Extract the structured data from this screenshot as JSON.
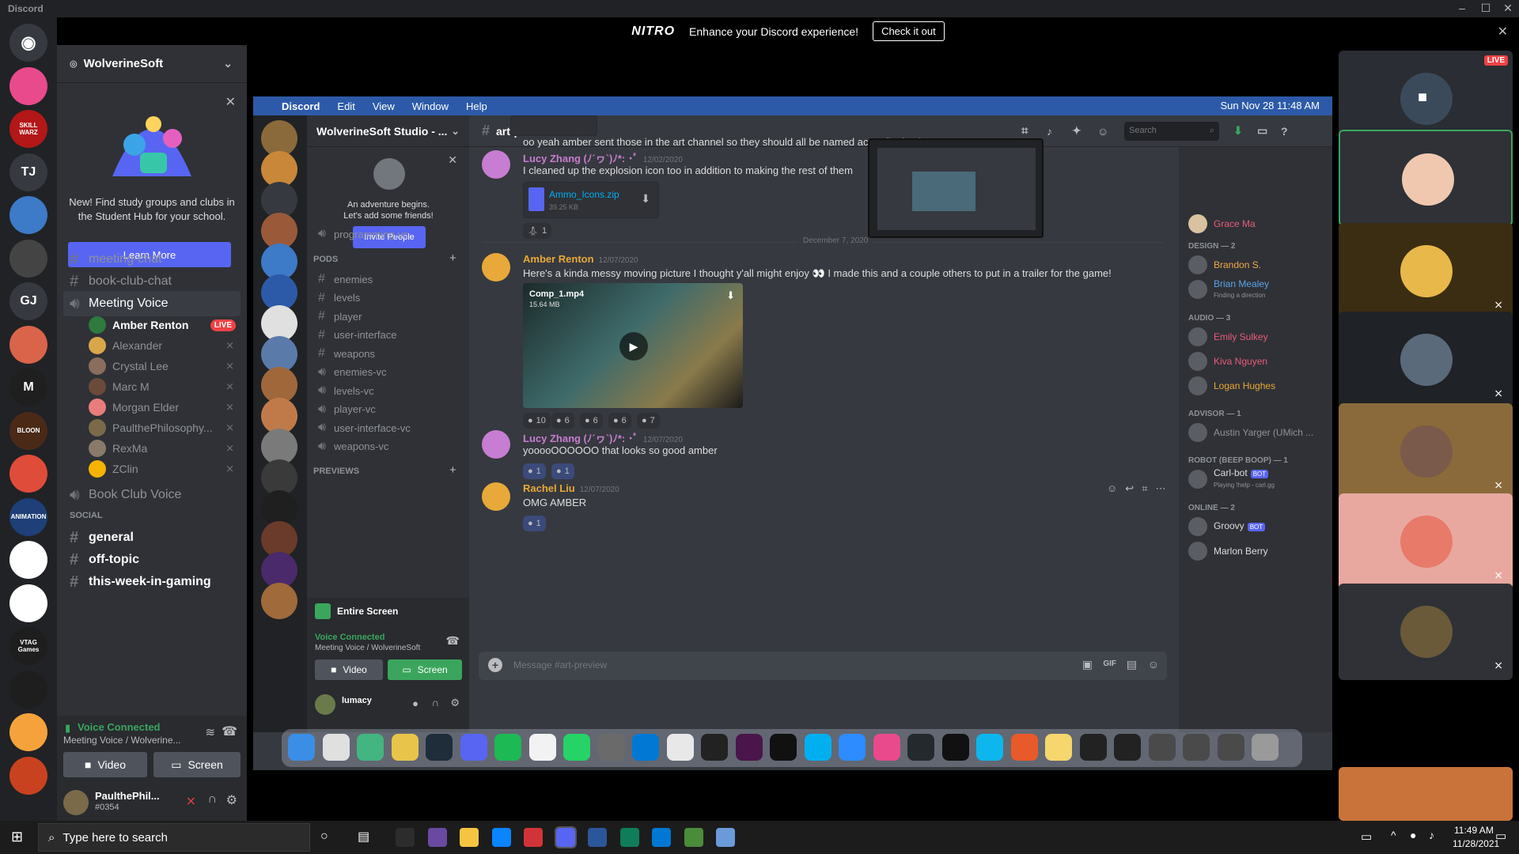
{
  "app": {
    "title": "Discord"
  },
  "nitro": {
    "logo": "NITRO",
    "text": "Enhance your Discord experience!",
    "cta": "Check it out"
  },
  "guild_rail": [
    {
      "name": "home",
      "label": "",
      "color": "#36393f"
    },
    {
      "name": "server-p",
      "label": "",
      "color": "#e94a8c"
    },
    {
      "name": "skillwarz",
      "label": "SKILL WARZ",
      "color": "#b31717"
    },
    {
      "name": "tj",
      "label": "TJ",
      "color": "#36393f"
    },
    {
      "name": "robot",
      "label": "",
      "color": "#3d7ac7"
    },
    {
      "name": "controller",
      "label": "",
      "color": "#444"
    },
    {
      "name": "gj",
      "label": "GJ",
      "color": "#36393f"
    },
    {
      "name": "ui-server",
      "label": "",
      "color": "#d9644a"
    },
    {
      "name": "m-server",
      "label": "M",
      "color": "#1f1f1f"
    },
    {
      "name": "bloon",
      "label": "BLOON",
      "color": "#4a2a17"
    },
    {
      "name": "colorful",
      "label": "",
      "color": "#e04c3a"
    },
    {
      "name": "animation",
      "label": "ANIMATION",
      "color": "#1e3f78"
    },
    {
      "name": "wolverine1",
      "label": "",
      "color": "#fff"
    },
    {
      "name": "wolverine2",
      "label": "",
      "color": "#fff"
    },
    {
      "name": "vtag",
      "label": "VTAG Games",
      "color": "#1e1e1e"
    },
    {
      "name": "trophy",
      "label": "",
      "color": "#1e1e1e"
    },
    {
      "name": "fox",
      "label": "",
      "color": "#f6a23c"
    },
    {
      "name": "dark",
      "label": "",
      "color": "#c9421f"
    }
  ],
  "server": {
    "name": "WolverineSoft"
  },
  "promo": {
    "text": "New! Find study groups and clubs in the Student Hub for your school.",
    "button": "Learn More"
  },
  "channels": [
    {
      "type": "text",
      "name": "meeting-chat"
    },
    {
      "type": "text",
      "name": "book-club-chat"
    },
    {
      "type": "voice",
      "name": "Meeting Voice"
    }
  ],
  "voice_users": [
    {
      "name": "Amber Renton",
      "live": "LIVE",
      "color": "#2f7a3e"
    },
    {
      "name": "Alexander",
      "color": "#d9a64a"
    },
    {
      "name": "Crystal Lee",
      "color": "#8a6d5c"
    },
    {
      "name": "Marc M",
      "color": "#6b4a3a"
    },
    {
      "name": "Morgan Elder",
      "color": "#e97c7c"
    },
    {
      "name": "PaulthePhilosophy...",
      "color": "#7a6a4a"
    },
    {
      "name": "RexMa",
      "color": "#8a7a6a"
    },
    {
      "name": "ZClin",
      "color": "#f5b400"
    }
  ],
  "channels_after": [
    {
      "type": "voice",
      "name": "Book Club Voice"
    }
  ],
  "category_social": "SOCIAL",
  "social_channels": [
    "general",
    "off-topic",
    "this-week-in-gaming"
  ],
  "voice_panel": {
    "status": "Voice Connected",
    "location": "Meeting Voice / Wolverine...",
    "video": "Video",
    "screen": "Screen"
  },
  "user": {
    "name": "PaulthePhil...",
    "tag": "#0354"
  },
  "mac": {
    "menubar": [
      "Discord",
      "Edit",
      "View",
      "Window",
      "Help"
    ],
    "clock": "Sun Nov 28  11:48 AM",
    "server_name": "WolverineSoft Studio - ...",
    "adventure": "An adventure begins.\nLet's add some friends!",
    "invite": "Invite People",
    "channel_top": "programming-vc",
    "pods_label": "PODS",
    "pods": [
      {
        "type": "text",
        "name": "enemies"
      },
      {
        "type": "text",
        "name": "levels"
      },
      {
        "type": "text",
        "name": "player"
      },
      {
        "type": "text",
        "name": "user-interface"
      },
      {
        "type": "text",
        "name": "weapons"
      },
      {
        "type": "voice",
        "name": "enemies-vc"
      },
      {
        "type": "voice",
        "name": "levels-vc"
      },
      {
        "type": "voice",
        "name": "player-vc"
      },
      {
        "type": "voice",
        "name": "user-interface-vc"
      },
      {
        "type": "voice",
        "name": "weapons-vc"
      }
    ],
    "previews_label": "PREVIEWS",
    "entire_screen": "Entire Screen",
    "vc_status": "Voice Connected",
    "vc_location": "Meeting Voice / WolverineSoft",
    "video": "Video",
    "screen": "Screen",
    "user": "lumacy",
    "chat_channel": "art-preview",
    "search": "Search",
    "messages": [
      {
        "text": "oo yeah amber sent those in the art channel so they should all be named accordingly B)"
      },
      {
        "author": "Lucy Zhang (ﾉ´ヮ`)ﾉ*: ･ﾟ",
        "time": "12/02/2020",
        "text": "I cleaned up the explosion icon too in addition to making the rest of them",
        "color": "#c77dd1",
        "file": "Ammo_Icons.zip",
        "size": "39.25 KB",
        "reaction": "1"
      },
      {
        "divider": "December 7, 2020"
      },
      {
        "author": "Amber Renton",
        "time": "12/07/2020",
        "text": "Here's a kinda messy moving picture I thought y'all might enjoy 👀 I made this and a couple others to put in a trailer for the game!",
        "color": "#e8a93a",
        "video": "Comp_1.mp4",
        "vsize": "15.64 MB",
        "reactions": [
          "10",
          "6",
          "6",
          "6",
          "7"
        ]
      },
      {
        "author": "Lucy Zhang (ﾉ´ヮ`)ﾉ*: ･ﾟ",
        "time": "12/07/2020",
        "text": "yooooOOOOOO that looks so good amber",
        "color": "#c77dd1",
        "reactions": [
          "1",
          "1"
        ]
      },
      {
        "author": "Rachel Liu",
        "time": "12/07/2020",
        "text": "OMG  AMBER",
        "color": "#e8a93a",
        "reactions": [
          "1"
        ]
      }
    ],
    "composer": "Message #art-preview",
    "member_groups": [
      {
        "title": "DESIGN — 2",
        "members": [
          {
            "name": "Brandon S.",
            "color": "#f0a847"
          },
          {
            "name": "Brian Mealey",
            "color": "#5aa3e8",
            "sub": "Finding a direction"
          }
        ]
      },
      {
        "title": "AUDIO — 3",
        "members": [
          {
            "name": "Emily Sulkey",
            "color": "#e95b7a"
          },
          {
            "name": "Kiva Nguyen",
            "color": "#e95b7a"
          },
          {
            "name": "Logan Hughes",
            "color": "#e8a93a"
          }
        ]
      },
      {
        "title": "ADVISOR — 1",
        "members": [
          {
            "name": "Austin Yarger (UMich ...",
            "color": "#8e9297"
          }
        ]
      },
      {
        "title": "ROBOT (BEEP BOOP) — 1",
        "members": [
          {
            "name": "Carl-bot",
            "color": "#dcddde",
            "bot": "BOT",
            "sub": "Playing !help - carl.gg"
          }
        ]
      },
      {
        "title": "ONLINE — 2",
        "members": [
          {
            "name": "Groovy",
            "color": "#dcddde",
            "bot": "BOT"
          },
          {
            "name": "Marlon Berry",
            "color": "#dcddde"
          }
        ]
      }
    ],
    "top_member": "Grace Ma"
  },
  "tiles": {
    "live": "LIVE"
  },
  "taskbar": {
    "search": "Type here to search",
    "time": "11:49 AM",
    "date": "11/28/2021"
  }
}
